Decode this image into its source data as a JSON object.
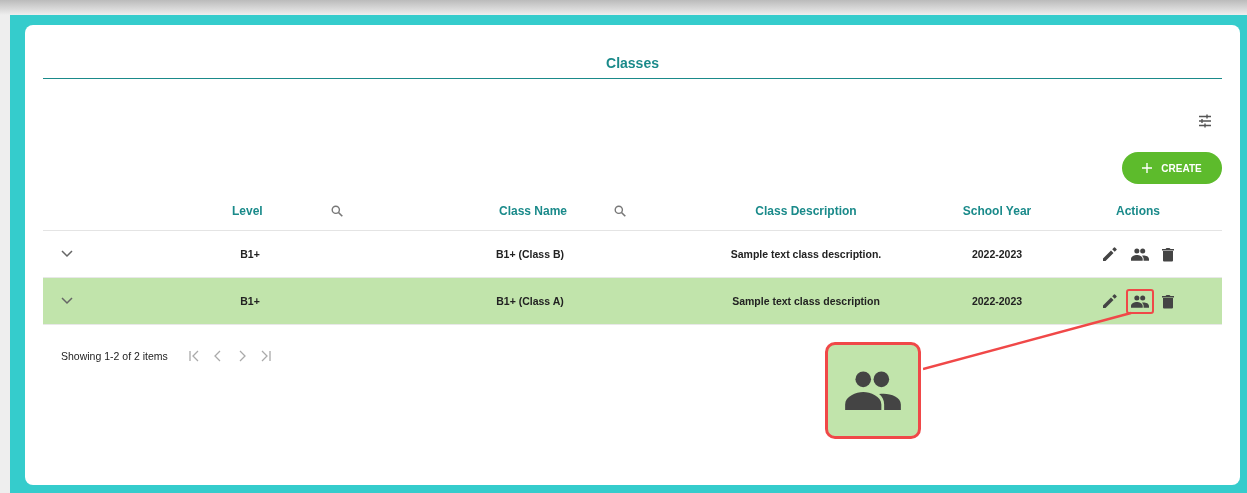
{
  "title": "Classes",
  "create_button": {
    "label": "CREATE"
  },
  "table": {
    "columns": [
      {
        "label": "Level",
        "searchable": true
      },
      {
        "label": "Class Name",
        "searchable": true
      },
      {
        "label": "Class Description",
        "searchable": false
      },
      {
        "label": "School Year",
        "searchable": false
      },
      {
        "label": "Actions",
        "searchable": false
      }
    ],
    "rows": [
      {
        "level": "B1+",
        "class_name": "B1+ (Class B)",
        "description": "Sample text class description.",
        "school_year": "2022-2023",
        "selected": false,
        "members_highlighted": false
      },
      {
        "level": "B1+",
        "class_name": "B1+ (Class A)",
        "description": "Sample text class description",
        "school_year": "2022-2023",
        "selected": true,
        "members_highlighted": true
      }
    ]
  },
  "pagination": {
    "summary": "Showing 1-2 of 2 items"
  }
}
